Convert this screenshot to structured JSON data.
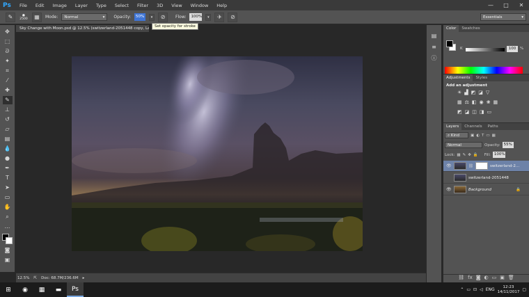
{
  "menubar": {
    "logo": "Ps",
    "items": [
      "File",
      "Edit",
      "Image",
      "Layer",
      "Type",
      "Select",
      "Filter",
      "3D",
      "View",
      "Window",
      "Help"
    ],
    "minimize": "—",
    "maximize": "□",
    "close": "✕"
  },
  "options": {
    "brush_size": "2500",
    "mode_label": "Mode:",
    "mode_value": "Normal",
    "opacity_label": "Opacity:",
    "opacity_value": "50%",
    "flow_label": "Flow:",
    "flow_value": "100%",
    "tooltip": "Set opacity for stroke",
    "workspace": "Essentials"
  },
  "document": {
    "tab_title": "Sky Change with Moon.psd @ 12.5% (switzerland-2051448 copy, Layer Mask/8) *",
    "zoom": "12.5%",
    "doc_info": "Doc: 68.7M/236.6M"
  },
  "panels": {
    "color_tab": "Color",
    "swatches_tab": "Swatches",
    "k_label": "K",
    "k_value": "100",
    "pct": "%",
    "adjustments_tab": "Adjustments",
    "styles_tab": "Styles",
    "adjust_title": "Add an adjustment",
    "layers_tab": "Layers",
    "channels_tab": "Channels",
    "paths_tab": "Paths",
    "kind_label": "Kind",
    "blend_mode": "Normal",
    "opacity_label": "Opacity:",
    "opacity_value": "55%",
    "lock_label": "Lock:",
    "fill_label": "Fill:",
    "fill_value": "100%"
  },
  "layers": [
    {
      "name": "switzerland-2...",
      "visible": true,
      "selected": true,
      "has_mask": true
    },
    {
      "name": "switzerland-2051448",
      "visible": false,
      "selected": false,
      "has_mask": false
    },
    {
      "name": "Background",
      "visible": true,
      "selected": false,
      "has_mask": false
    }
  ],
  "taskbar": {
    "language": "ENG",
    "time": "12:23",
    "date": "14/11/2017"
  },
  "colors": {
    "accent": "#31a8ff",
    "selection": "#3f75d6",
    "layer_selected": "#6d82a8"
  }
}
